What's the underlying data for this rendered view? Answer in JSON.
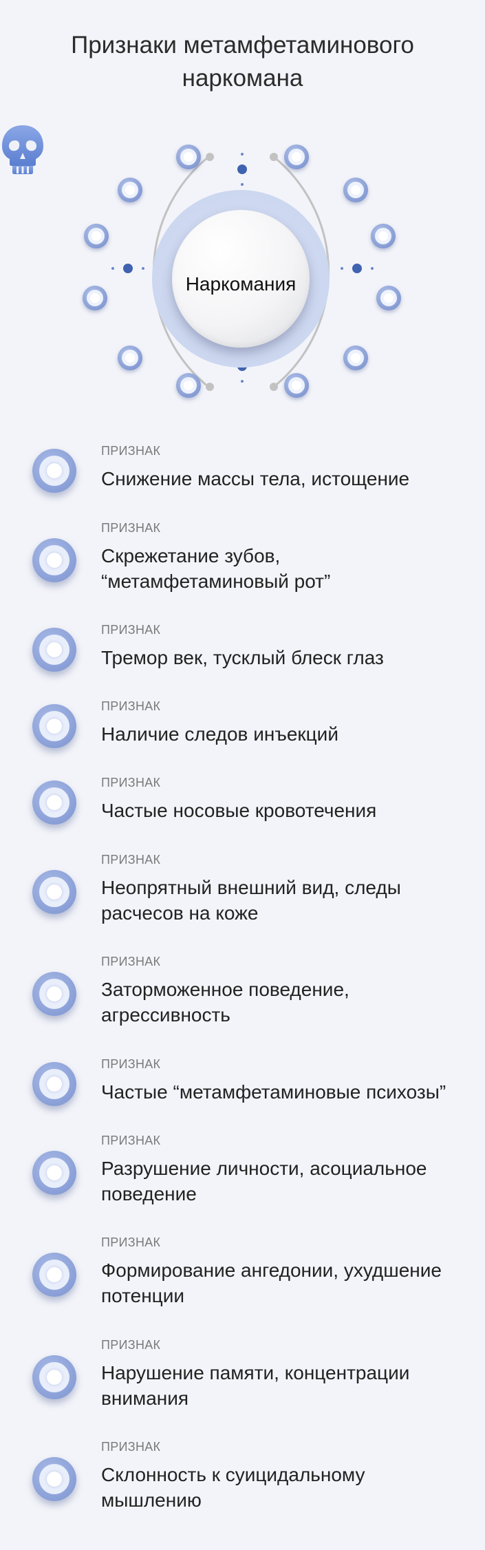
{
  "title": "Признаки метамфетаминового\nнаркомана",
  "diagram": {
    "center_label": "Наркомания",
    "center_icon": "skull-icon",
    "accent_color": "#8ea3d9",
    "ring_color": "#c0c0c0",
    "dot_color": "#3f63b0"
  },
  "signs": [
    {
      "label": "ПРИЗНАК",
      "text": "Снижение массы тела, истощение"
    },
    {
      "label": "ПРИЗНАК",
      "text": "Скрежетание зубов,\n“метамфетаминовый рот”"
    },
    {
      "label": "ПРИЗНАК",
      "text": "Тремор век, тусклый блеск глаз"
    },
    {
      "label": "ПРИЗНАК",
      "text": "Наличие следов инъекций"
    },
    {
      "label": "ПРИЗНАК",
      "text": "Частые носовые кровотечения"
    },
    {
      "label": "ПРИЗНАК",
      "text": "Неопрятный внешний вид, следы\nрасчесов на коже"
    },
    {
      "label": "ПРИЗНАК",
      "text": "Заторможенное поведение,\nагрессивность"
    },
    {
      "label": "ПРИЗНАК",
      "text": "Частые “метамфетаминовые психозы”"
    },
    {
      "label": "ПРИЗНАК",
      "text": "Разрушение личности, асоциальное\nповедение"
    },
    {
      "label": "ПРИЗНАК",
      "text": "Формирование ангедонии, ухудшение\nпотенции"
    },
    {
      "label": "ПРИЗНАК",
      "text": "Нарушение памяти, концентрации\nвнимания"
    },
    {
      "label": "ПРИЗНАК",
      "text": "Склонность к суицидальному\nмышлению"
    }
  ]
}
